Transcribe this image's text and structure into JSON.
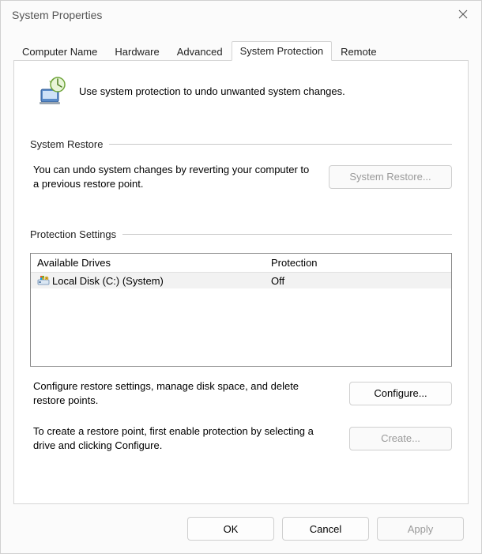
{
  "window": {
    "title": "System Properties"
  },
  "tabs": [
    {
      "label": "Computer Name",
      "active": false
    },
    {
      "label": "Hardware",
      "active": false
    },
    {
      "label": "Advanced",
      "active": false
    },
    {
      "label": "System Protection",
      "active": true
    },
    {
      "label": "Remote",
      "active": false
    }
  ],
  "intro_text": "Use system protection to undo unwanted system changes.",
  "groups": {
    "system_restore": {
      "label": "System Restore",
      "description": "You can undo system changes by reverting your computer to a previous restore point.",
      "button_label": "System Restore...",
      "button_enabled": false
    },
    "protection_settings": {
      "label": "Protection Settings",
      "columns": {
        "drives": "Available Drives",
        "protection": "Protection"
      },
      "drives": [
        {
          "name": "Local Disk (C:) (System)",
          "protection": "Off"
        }
      ],
      "configure_text": "Configure restore settings, manage disk space, and delete restore points.",
      "configure_label": "Configure...",
      "configure_enabled": true,
      "create_text": "To create a restore point, first enable protection by selecting a drive and clicking Configure.",
      "create_label": "Create...",
      "create_enabled": false
    }
  },
  "footer": {
    "ok": "OK",
    "cancel": "Cancel",
    "apply": "Apply",
    "apply_enabled": false
  }
}
